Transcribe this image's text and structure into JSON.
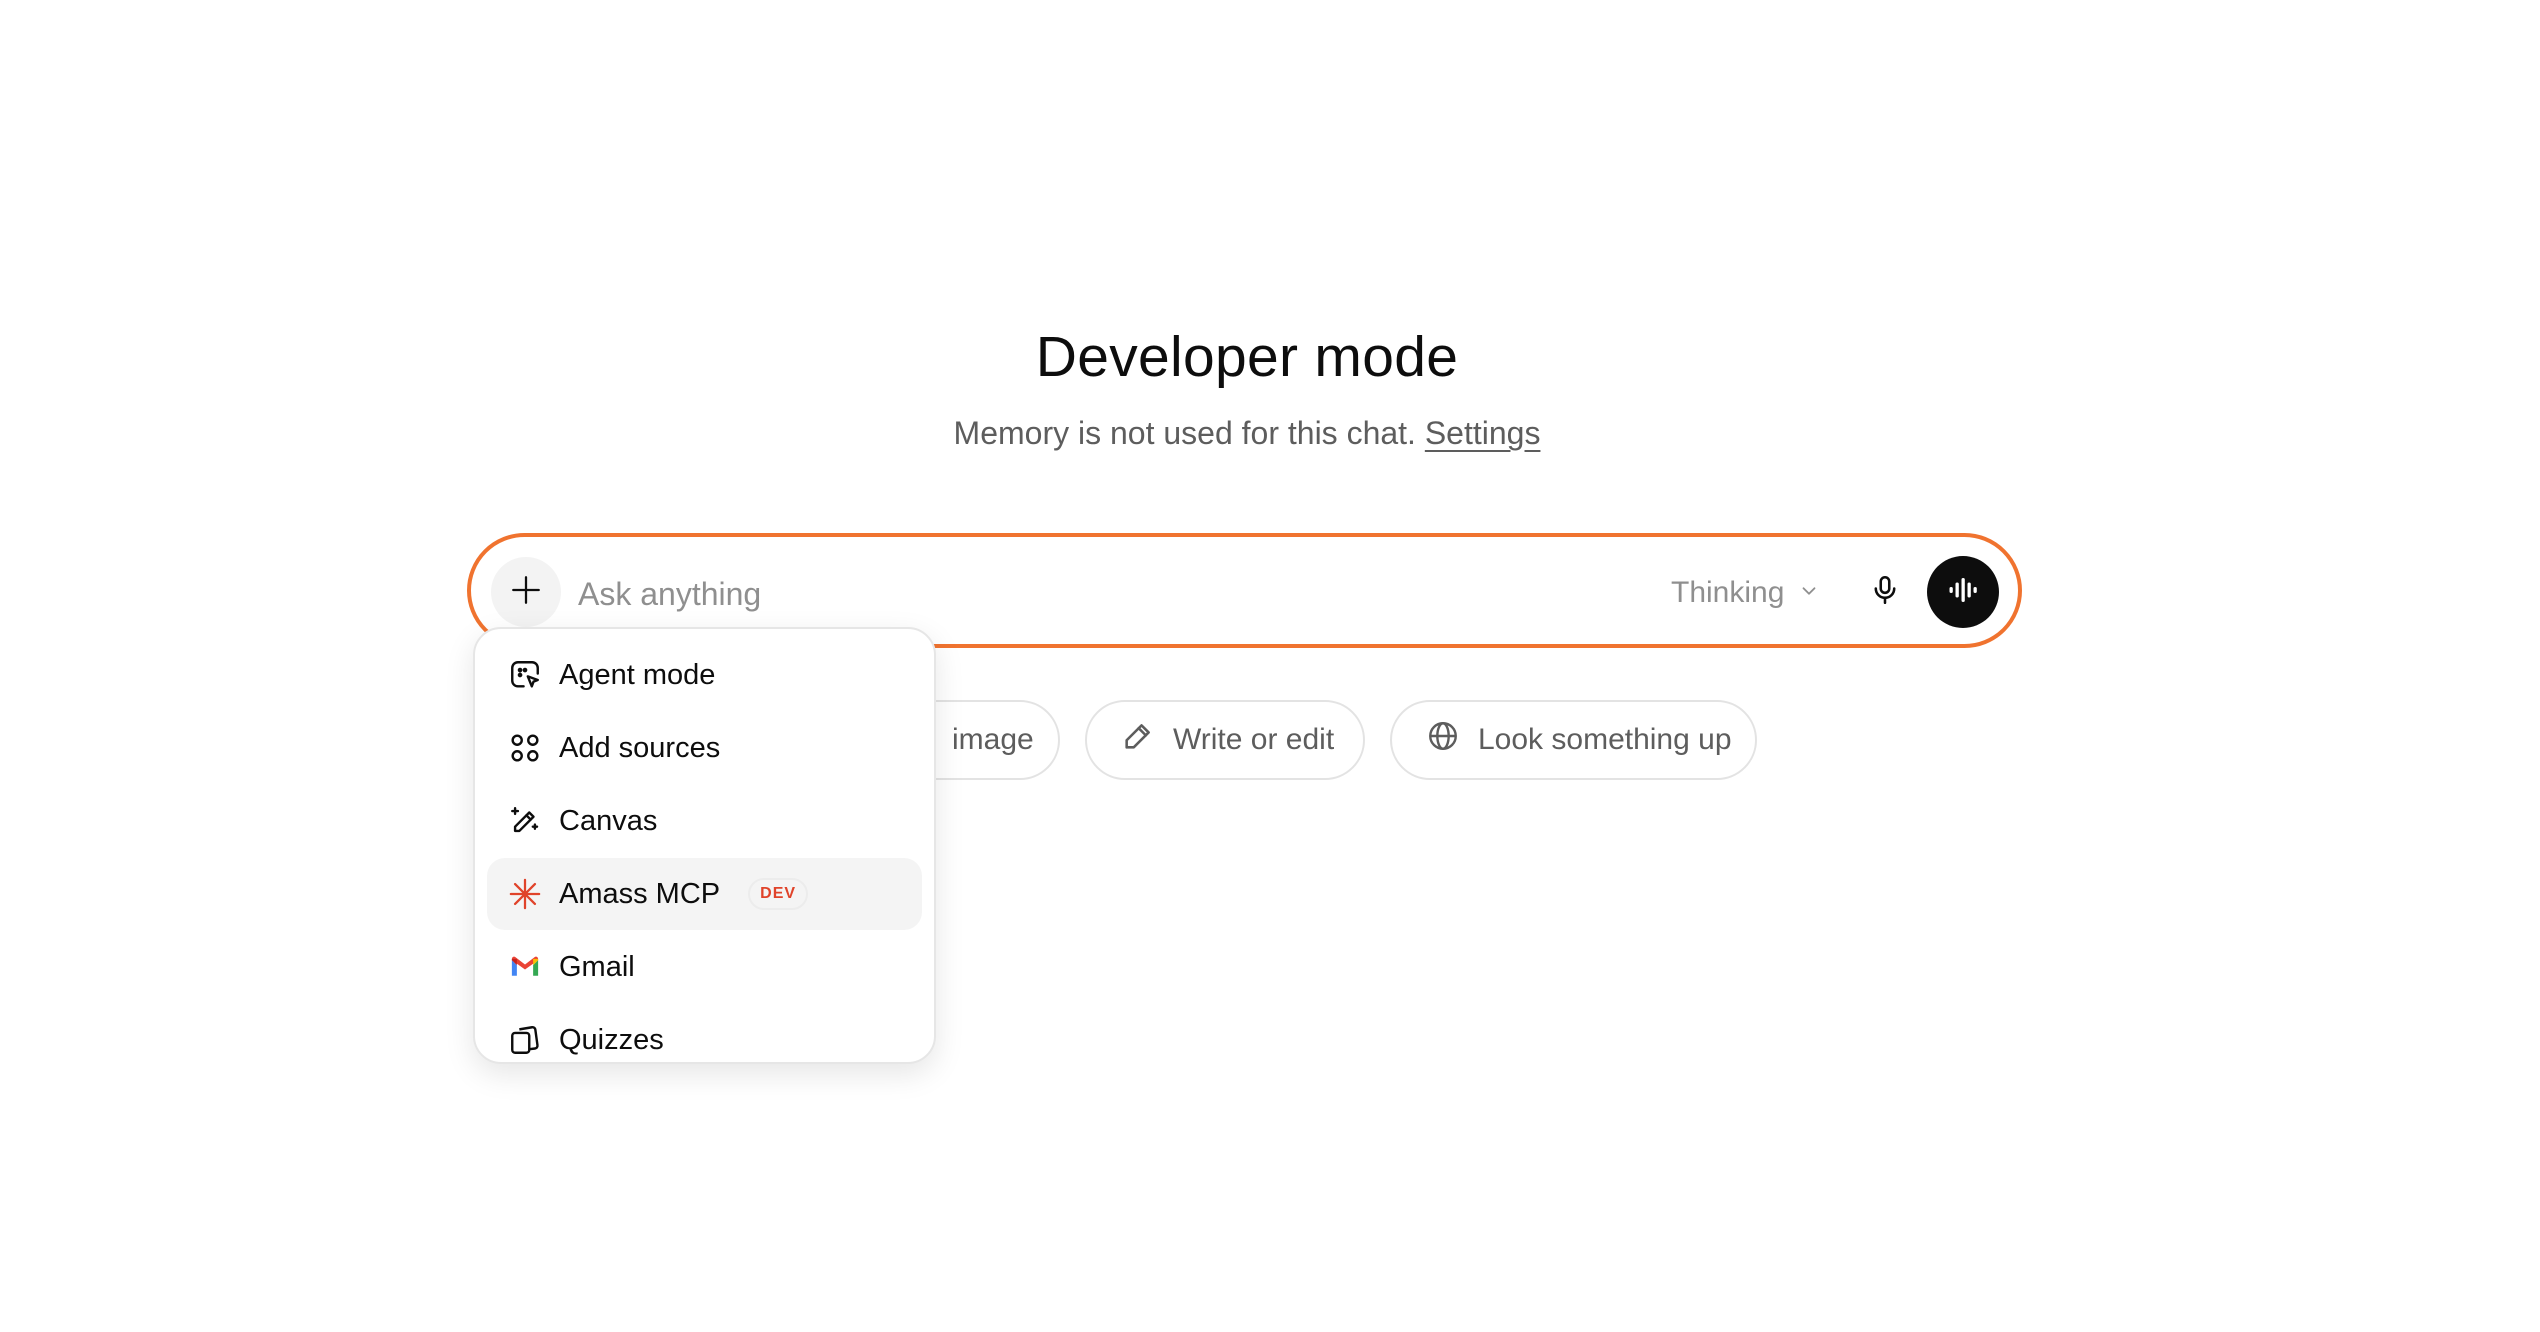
{
  "header": {
    "title": "Developer mode",
    "subtitle_text": "Memory is not used for this chat.",
    "settings_link": "Settings"
  },
  "composer": {
    "placeholder": "Ask anything",
    "model_label": "Thinking",
    "accent_color": "#f0732f"
  },
  "chips": {
    "partial_label": "image",
    "write_label": "Write or edit",
    "look_label": "Look something up"
  },
  "menu": {
    "items": [
      {
        "label": "Agent mode",
        "icon": "agent-icon"
      },
      {
        "label": "Add sources",
        "icon": "sources-icon"
      },
      {
        "label": "Canvas",
        "icon": "canvas-icon"
      },
      {
        "label": "Amass MCP",
        "icon": "amass-icon",
        "badge": "DEV"
      },
      {
        "label": "Gmail",
        "icon": "gmail-icon"
      },
      {
        "label": "Quizzes",
        "icon": "quizzes-icon"
      }
    ]
  }
}
